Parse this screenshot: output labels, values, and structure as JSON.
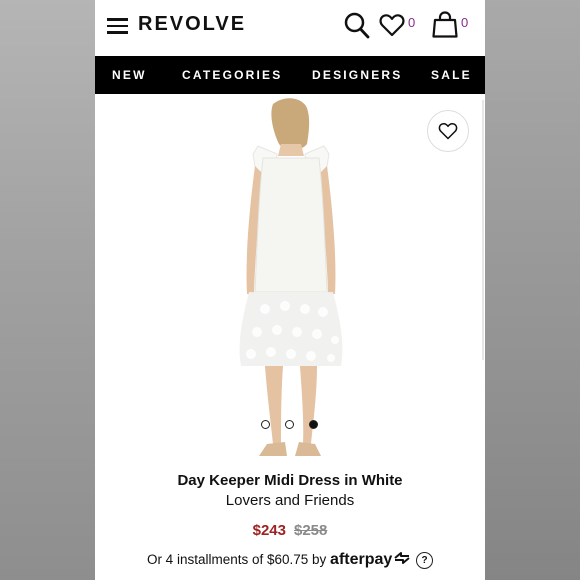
{
  "header": {
    "logo": "REVOLVE",
    "wishlist_count": "0",
    "cart_count": "0"
  },
  "nav": {
    "items": [
      "NEW",
      "CATEGORIES",
      "DESIGNERS",
      "SALE"
    ]
  },
  "gallery": {
    "slides": 3,
    "active_slide": 3
  },
  "product": {
    "name": "Day Keeper Midi Dress in White",
    "brand": "Lovers and Friends",
    "sale_price": "$243",
    "original_price": "$258",
    "installments": "Or 4 installments of $60.75 by",
    "afterpay": "afterpay",
    "help": "?"
  },
  "colors": {
    "nav_bg": "#000000",
    "sale": "#9c2323",
    "count": "#8b2a8e"
  }
}
